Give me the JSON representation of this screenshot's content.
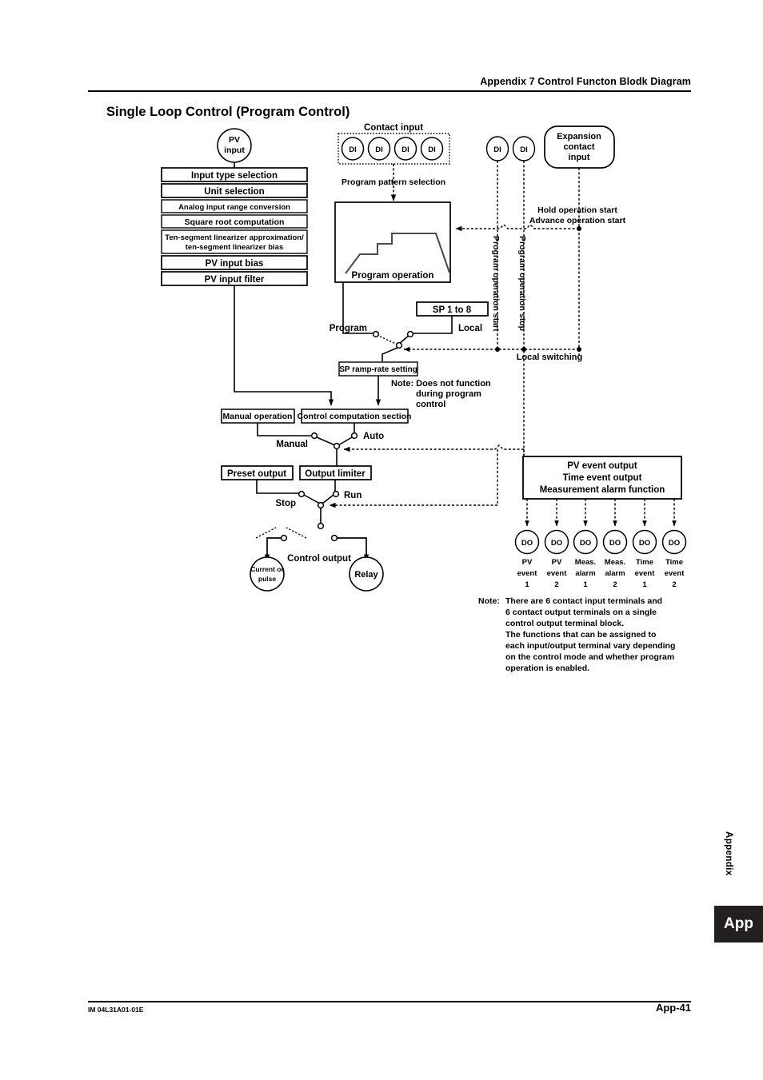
{
  "header": {
    "running_head": "Appendix 7 Control Functon Blodk Diagram",
    "page_heading": "Single Loop Control (Program Control)"
  },
  "footer": {
    "doc_number": "IM 04L31A01-01E",
    "page_number": "App-41",
    "side_label": "Appendix",
    "side_tab": "App"
  },
  "diagram": {
    "inputs": {
      "pv_input": "PV\ninput",
      "pv_input_line1": "PV",
      "pv_input_line2": "input",
      "contact_input_label": "Contact input",
      "di_label": "DI",
      "contact_input_di": [
        "DI",
        "DI",
        "DI",
        "DI"
      ],
      "standalone_di": [
        "DI",
        "DI"
      ],
      "expansion_contact_input_l1": "Expansion",
      "expansion_contact_input_l2": "contact",
      "expansion_contact_input_l3": "input"
    },
    "input_chain": [
      "Input type selection",
      "Unit selection",
      "Analog input range conversion",
      "Square root computation",
      "Ten-segment linearizer approximation/\nten-segment linearizer bias",
      "PV input bias",
      "PV input filter"
    ],
    "input_chain_boxes": {
      "input_type_selection": "Input type selection",
      "unit_selection": "Unit selection",
      "analog_input_range_conversion": "Analog input range conversion",
      "square_root_computation": "Square root computation",
      "ten_segment_line1": "Ten-segment linearizer approximation/",
      "ten_segment_line2": "ten-segment linearizer bias",
      "pv_input_bias": "PV input bias",
      "pv_input_filter": "PV input filter"
    },
    "program": {
      "pattern_selection_label": "Program pattern selection",
      "program_operation_label": "Program operation",
      "sp_1_to_8": "SP 1 to 8",
      "program_switch_label": "Program",
      "local_switch_label": "Local",
      "sp_ramp_rate_setting": "SP ramp-rate setting",
      "note_line1": "Note: Does not function",
      "note_line2": "during program",
      "note_line3": "control"
    },
    "control": {
      "manual_operation": "Manual operation",
      "control_computation_section": "Control computation section",
      "manual_label": "Manual",
      "auto_label": "Auto",
      "preset_output": "Preset output",
      "output_limiter": "Output limiter",
      "stop_label": "Stop",
      "run_label": "Run",
      "control_output_label": "Control output",
      "current_or_pulse_l1": "Current or",
      "current_or_pulse_l2": "pulse",
      "relay": "Relay"
    },
    "signals": {
      "hold_operation_start": "Hold operation start",
      "advance_operation_start": "Advance operation start",
      "program_operation_start": "Program operation start",
      "program_operation_stop": "Program operation stop",
      "local_switching": "Local switching"
    },
    "event_output": {
      "box_line1": "PV event output",
      "box_line2": "Time event output",
      "box_line3": "Measurement alarm function",
      "do_label": "DO",
      "terminals": [
        {
          "do": "DO",
          "l1": "PV",
          "l2": "event",
          "l3": "1"
        },
        {
          "do": "DO",
          "l1": "PV",
          "l2": "event",
          "l3": "2"
        },
        {
          "do": "DO",
          "l1": "Meas.",
          "l2": "alarm",
          "l3": "1"
        },
        {
          "do": "DO",
          "l1": "Meas.",
          "l2": "alarm",
          "l3": "2"
        },
        {
          "do": "DO",
          "l1": "Time",
          "l2": "event",
          "l3": "1"
        },
        {
          "do": "DO",
          "l1": "Time",
          "l2": "event",
          "l3": "2"
        }
      ]
    },
    "bottom_note": {
      "label": "Note:",
      "lines": [
        "There are 6 contact input terminals and",
        "6 contact output terminals on a single",
        "control output terminal block.",
        "The functions that can be assigned to",
        "each input/output terminal vary depending",
        "on the control mode and whether program",
        "operation is enabled."
      ]
    }
  }
}
